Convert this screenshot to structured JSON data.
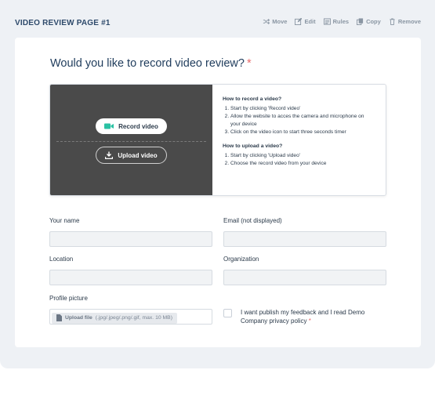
{
  "page": {
    "title": "VIDEO REVIEW PAGE #1"
  },
  "toolbar": {
    "move": "Move",
    "edit": "Edit",
    "rules": "Rules",
    "copy": "Copy",
    "remove": "Remove"
  },
  "form": {
    "question": "Would you like to record video review?",
    "required_mark": "*",
    "record_button": "Record video",
    "upload_button": "Upload video",
    "record_help": {
      "title": "How to record a video?",
      "steps": [
        "Start by clicking 'Record video'",
        "Allow the website to acces the camera and microphone on your device",
        "Click on the video icon to start three seconds timer"
      ]
    },
    "upload_help": {
      "title": "How to upload a video?",
      "steps": [
        "Start by clicking 'Upload video'",
        "Choose the record video from your device"
      ]
    },
    "fields": {
      "your_name": {
        "label": "Your name",
        "value": ""
      },
      "email": {
        "label": "Email (not displayed)",
        "value": ""
      },
      "location": {
        "label": "Location",
        "value": ""
      },
      "organization": {
        "label": "Organization",
        "value": ""
      },
      "profile_picture": {
        "label": "Profile picture",
        "upload_label": "Upload file",
        "hint": "(.jpg/.jpeg/.png/.gif, max. 10 MB)"
      }
    },
    "consent": {
      "text": "I want publish my feedback and I read Demo Company privacy policy",
      "required_mark": "*"
    }
  },
  "colors": {
    "record_icon": "#2bc2a4",
    "required": "#e86a6a",
    "video_bg": "#4a4a4a",
    "title": "#1f3c5c"
  }
}
